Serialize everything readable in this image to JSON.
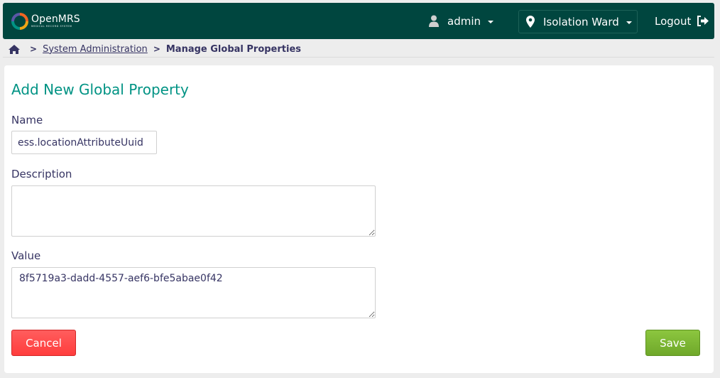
{
  "header": {
    "logo_name": "OpenMRS",
    "logo_tagline": "MEDICAL RECORD SYSTEM",
    "user_label": "admin",
    "location_label": "Isolation Ward",
    "logout_label": "Logout",
    "icons": [
      "user-icon",
      "map-pin-icon",
      "logout-icon"
    ],
    "bg_color": "#00463f"
  },
  "breadcrumb": {
    "home_icon": "home-icon",
    "items": [
      {
        "label": "System Administration"
      },
      {
        "label": "Manage Global Properties"
      }
    ]
  },
  "form": {
    "title": "Add New Global Property",
    "name_label": "Name",
    "name_value": "ess.locationAttributeUuid",
    "description_label": "Description",
    "description_value": "",
    "value_label": "Value",
    "value_value": "8f5719a3-dadd-4557-aef6-bfe5abae0f42",
    "cancel_label": "Cancel",
    "save_label": "Save",
    "title_color": "#009384",
    "cancel_color": "#ff3d3d",
    "save_color": "#7cb734"
  }
}
